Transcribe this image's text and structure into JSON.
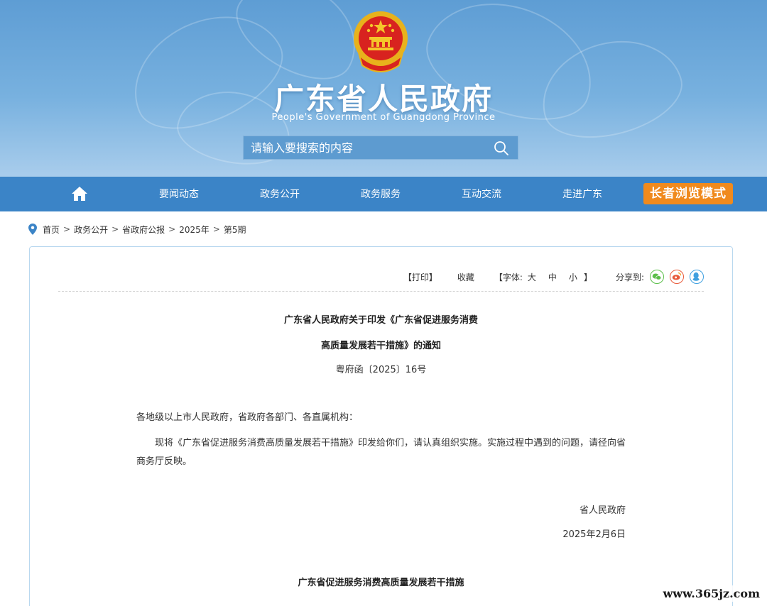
{
  "header": {
    "title": "广东省人民政府",
    "subtitle": "People's Government of Guangdong Province",
    "search_placeholder": "请输入要搜索的内容"
  },
  "nav": {
    "items": [
      "要闻动态",
      "政务公开",
      "政务服务",
      "互动交流",
      "走进广东"
    ],
    "elder_mode": "长者浏览模式"
  },
  "breadcrumb": [
    "首页",
    "政务公开",
    "省政府公报",
    "2025年",
    "第5期"
  ],
  "toolbar": {
    "print": "【打印】",
    "favorite": "收藏",
    "font_label": "【字体:",
    "font_large": "大",
    "font_medium": "中",
    "font_small": "小",
    "font_close": "】",
    "share_label": "分享到:"
  },
  "document": {
    "title_line1": "广东省人民政府关于印发《广东省促进服务消费",
    "title_line2": "高质量发展若干措施》的通知",
    "doc_number": "粤府函〔2025〕16号",
    "salutation": "各地级以上市人民政府，省政府各部门、各直属机构：",
    "body": "现将《广东省促进服务消费高质量发展若干措施》印发给你们，请认真组织实施。实施过程中遇到的问题，请径向省商务厅反映。",
    "signer": "省人民政府",
    "date": "2025年2月6日",
    "attachment_title": "广东省促进服务消费高质量发展若干措施"
  },
  "watermark": "www.365jz.com",
  "colors": {
    "header_top": "#5e9dd4",
    "nav_bg": "#3b84c7",
    "elder_btn": "#f08a1d",
    "content_border": "#b9d8ef"
  }
}
